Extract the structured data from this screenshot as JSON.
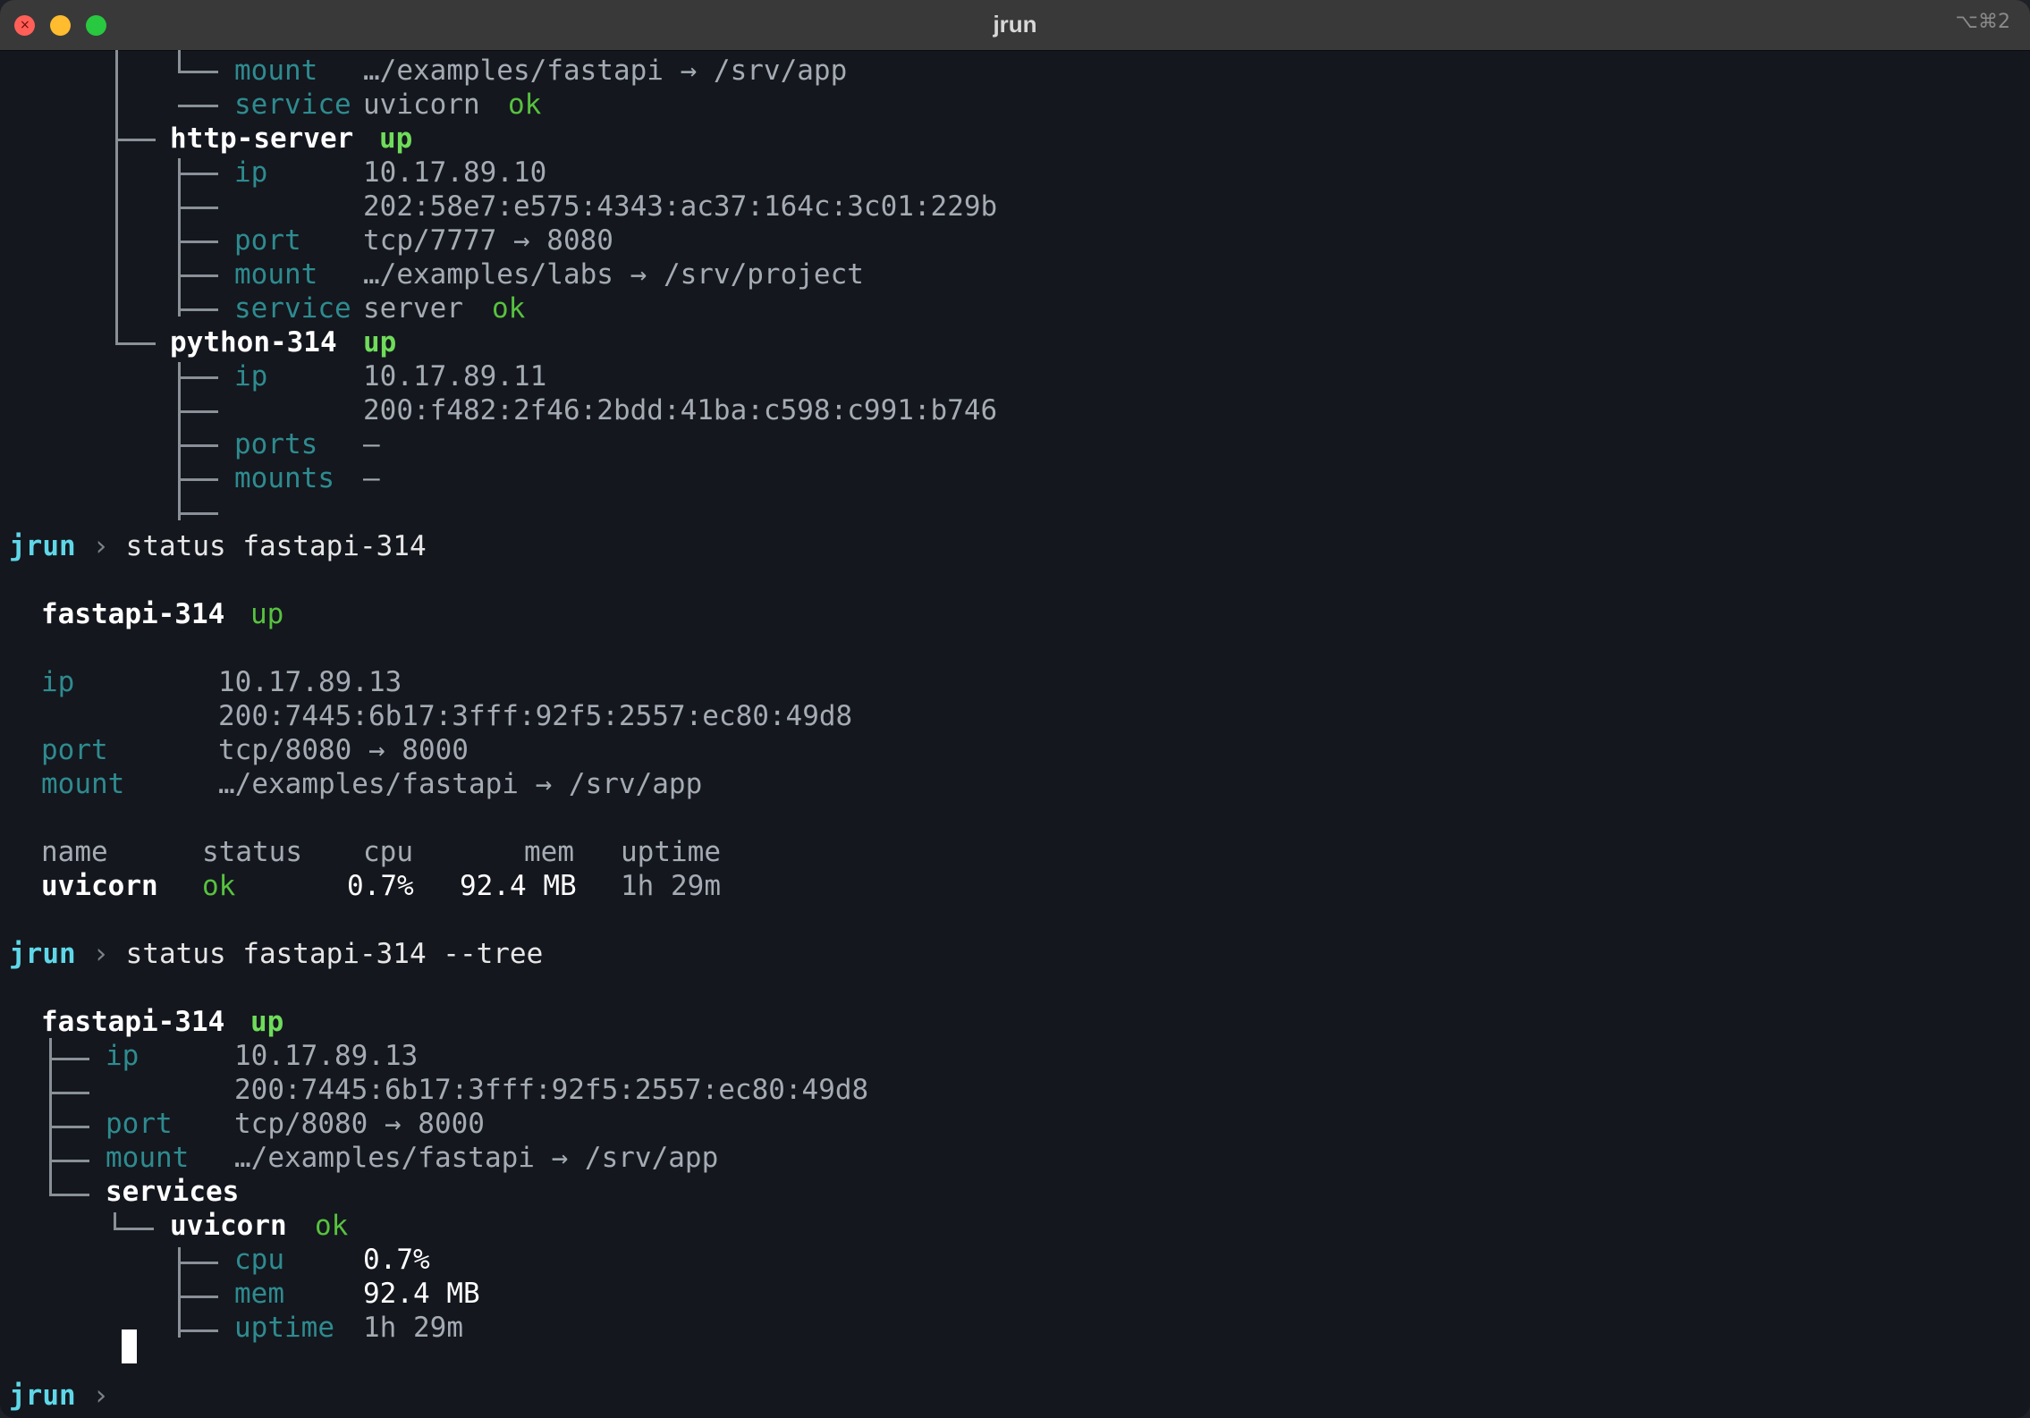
{
  "window": {
    "title": "jrun",
    "shortcut": "⌥⌘2"
  },
  "top_tree": {
    "fastapi_tail": [
      {
        "key": "mount",
        "value": "…/examples/fastapi → /srv/app"
      },
      {
        "key": "service",
        "value": "uvicorn",
        "status": "ok"
      }
    ],
    "http_server": {
      "name": "http-server",
      "state": "up",
      "rows": [
        {
          "key": "ip",
          "value": "10.17.89.10"
        },
        {
          "key": "",
          "value": "202:58e7:e575:4343:ac37:164c:3c01:229b"
        },
        {
          "key": "port",
          "value": "tcp/7777 → 8080"
        },
        {
          "key": "mount",
          "value": "…/examples/labs → /srv/project"
        },
        {
          "key": "service",
          "value": "server",
          "status": "ok"
        }
      ]
    },
    "python_314": {
      "name": "python-314",
      "state": "up",
      "rows": [
        {
          "key": "ip",
          "value": "10.17.89.11"
        },
        {
          "key": "",
          "value": "200:f482:2f46:2bdd:41ba:c598:c991:b746"
        },
        {
          "key": "ports",
          "value": "—"
        },
        {
          "key": "mounts",
          "value": "—"
        }
      ]
    }
  },
  "prompt": {
    "name": "jrun",
    "chevron": "›"
  },
  "cmd1": "status fastapi-314",
  "status": {
    "name": "fastapi-314",
    "state": "up",
    "rows": [
      {
        "key": "ip",
        "value": "10.17.89.13"
      },
      {
        "key": "",
        "value": "200:7445:6b17:3fff:92f5:2557:ec80:49d8"
      },
      {
        "key": "port",
        "value": "tcp/8080 → 8000"
      },
      {
        "key": "mount",
        "value": "…/examples/fastapi → /srv/app"
      }
    ],
    "table": {
      "headers": [
        "name",
        "status",
        "cpu",
        "mem",
        "uptime"
      ],
      "row": {
        "name": "uvicorn",
        "status": "ok",
        "cpu": "0.7%",
        "mem": "92.4 MB",
        "uptime": "1h 29m"
      }
    }
  },
  "cmd2": "status fastapi-314 --tree",
  "tree": {
    "name": "fastapi-314",
    "state": "up",
    "rows": [
      {
        "key": "ip",
        "value": "10.17.89.13"
      },
      {
        "key": "",
        "value": "200:7445:6b17:3fff:92f5:2557:ec80:49d8"
      },
      {
        "key": "port",
        "value": "tcp/8080 → 8000"
      },
      {
        "key": "mount",
        "value": "…/examples/fastapi → /srv/app"
      }
    ],
    "services_label": "services",
    "service": {
      "name": "uvicorn",
      "status": "ok"
    },
    "metrics": [
      {
        "key": "cpu",
        "value": "0.7%"
      },
      {
        "key": "mem",
        "value": "92.4 MB"
      },
      {
        "key": "uptime",
        "value": "1h 29m"
      }
    ]
  }
}
